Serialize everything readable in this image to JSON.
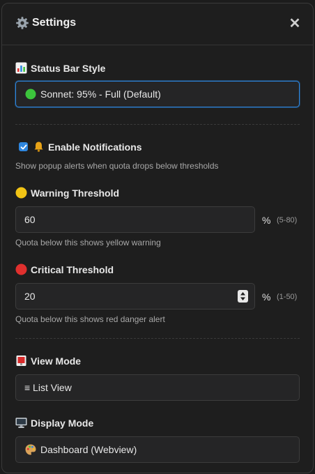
{
  "header": {
    "title": "Settings",
    "icon": "gear-icon",
    "close_label": "✕"
  },
  "status_bar": {
    "label": "Status Bar Style",
    "icon": "bar-chart-icon",
    "selected": "Sonnet: 95% - Full (Default)",
    "selected_icon": "green-circle-icon"
  },
  "notifications": {
    "checked": true,
    "label": "Enable Notifications",
    "icon": "bell-icon",
    "help": "Show popup alerts when quota drops below thresholds"
  },
  "warning": {
    "label": "Warning Threshold",
    "icon": "yellow-circle-icon",
    "value": "60",
    "unit": "%",
    "range": "(5-80)",
    "help": "Quota below this shows yellow warning"
  },
  "critical": {
    "label": "Critical Threshold",
    "icon": "red-circle-icon",
    "value": "20",
    "unit": "%",
    "range": "(1-50)",
    "help": "Quota below this shows red danger alert"
  },
  "view_mode": {
    "label": "View Mode",
    "icon": "mailbox-icon",
    "selected": "≡ List View"
  },
  "display_mode": {
    "label": "Display Mode",
    "icon": "monitor-icon",
    "selected": "Dashboard (Webview)",
    "selected_icon": "palette-icon"
  },
  "colors": {
    "accent": "#2e86de",
    "green": "#3cc43c",
    "yellow": "#f2c415",
    "red": "#e0302e"
  }
}
